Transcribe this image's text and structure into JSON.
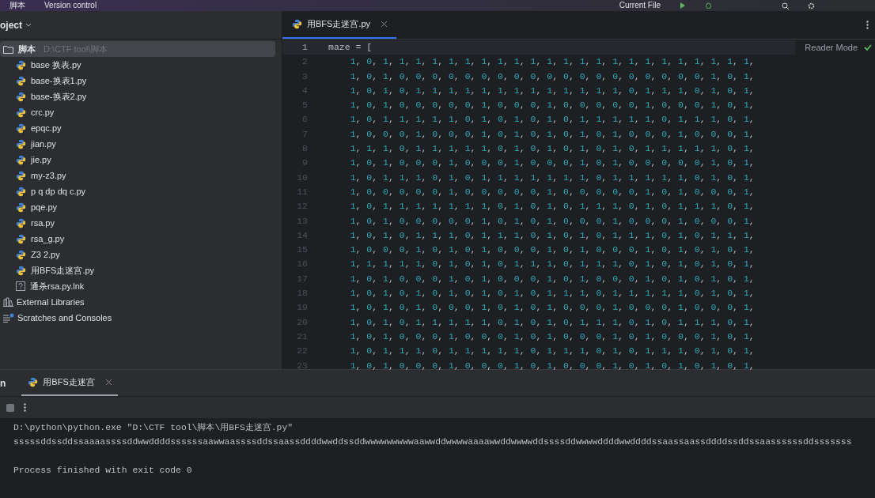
{
  "top_bar": {
    "project_name": "脚本",
    "vcs": "Version control",
    "run_config": "Current File"
  },
  "project_panel": {
    "title": "oject",
    "root": {
      "name": "脚本",
      "path": "D:\\CTF tool\\脚本",
      "selected": true,
      "children": [
        {
          "name": "base 换表.py",
          "kind": "python"
        },
        {
          "name": "base-换表1.py",
          "kind": "python"
        },
        {
          "name": "base-换表2.py",
          "kind": "python"
        },
        {
          "name": "crc.py",
          "kind": "python"
        },
        {
          "name": "epqc.py",
          "kind": "python"
        },
        {
          "name": "jian.py",
          "kind": "python"
        },
        {
          "name": "jie.py",
          "kind": "python"
        },
        {
          "name": "my-z3.py",
          "kind": "python"
        },
        {
          "name": "p q dp dq c.py",
          "kind": "python"
        },
        {
          "name": "pqe.py",
          "kind": "python"
        },
        {
          "name": "rsa.py",
          "kind": "python"
        },
        {
          "name": "rsa_g.py",
          "kind": "python"
        },
        {
          "name": "Z3 2.py",
          "kind": "python"
        },
        {
          "name": "用BFS走迷宫.py",
          "kind": "python"
        },
        {
          "name": "通杀rsa.py.lnk",
          "kind": "unknown"
        }
      ]
    },
    "extras": [
      {
        "name": "External Libraries",
        "kind": "library"
      },
      {
        "name": "Scratches and Consoles",
        "kind": "scratch"
      }
    ]
  },
  "editor": {
    "tabs": [
      {
        "label": "用BFS走迷宫.py",
        "selected": true
      }
    ],
    "reader_mode": "Reader Mode",
    "lines": [
      {
        "number": "1",
        "text": "maze = [",
        "current": true
      },
      {
        "number": "2",
        "text": "    1, 0, 1, 1, 1, 1, 1, 1, 1, 1, 1, 1, 1, 1, 1, 1, 1, 1, 1, 1, 1, 1, 1, 1, 1,",
        "current": false
      },
      {
        "number": "3",
        "text": "    1, 0, 1, 0, 0, 0, 0, 0, 0, 0, 0, 0, 0, 0, 0, 0, 0, 0, 0, 0, 0, 0, 1, 0, 1,",
        "current": false
      },
      {
        "number": "4",
        "text": "    1, 0, 1, 0, 1, 1, 1, 1, 1, 1, 1, 1, 1, 1, 1, 1, 1, 0, 1, 1, 1, 0, 1, 0, 1,",
        "current": false
      },
      {
        "number": "5",
        "text": "    1, 0, 1, 0, 0, 0, 0, 0, 1, 0, 0, 0, 1, 0, 0, 0, 0, 0, 1, 0, 0, 0, 1, 0, 1,",
        "current": false
      },
      {
        "number": "6",
        "text": "    1, 0, 1, 1, 1, 1, 1, 0, 1, 0, 1, 0, 1, 0, 1, 1, 1, 1, 1, 0, 1, 1, 1, 0, 1,",
        "current": false
      },
      {
        "number": "7",
        "text": "    1, 0, 0, 0, 1, 0, 0, 0, 1, 0, 1, 0, 1, 0, 1, 0, 1, 0, 0, 0, 1, 0, 0, 0, 1,",
        "current": false
      },
      {
        "number": "8",
        "text": "    1, 1, 1, 0, 1, 1, 1, 1, 1, 0, 1, 0, 1, 0, 1, 0, 1, 0, 1, 1, 1, 1, 1, 0, 1,",
        "current": false
      },
      {
        "number": "9",
        "text": "    1, 0, 1, 0, 0, 0, 1, 0, 0, 0, 1, 0, 0, 0, 1, 0, 1, 0, 0, 0, 0, 0, 1, 0, 1,",
        "current": false
      },
      {
        "number": "10",
        "text": "    1, 0, 1, 1, 1, 0, 1, 0, 1, 1, 1, 1, 1, 1, 1, 0, 1, 1, 1, 1, 1, 0, 1, 0, 1,",
        "current": false
      },
      {
        "number": "11",
        "text": "    1, 0, 0, 0, 0, 0, 1, 0, 0, 0, 0, 0, 1, 0, 0, 0, 0, 0, 1, 0, 1, 0, 0, 0, 1,",
        "current": false
      },
      {
        "number": "12",
        "text": "    1, 0, 1, 1, 1, 1, 1, 1, 1, 0, 1, 0, 1, 0, 1, 1, 1, 0, 1, 0, 1, 1, 1, 0, 1,",
        "current": false
      },
      {
        "number": "13",
        "text": "    1, 0, 1, 0, 0, 0, 0, 0, 1, 0, 1, 0, 1, 0, 0, 0, 1, 0, 0, 0, 1, 0, 0, 0, 1,",
        "current": false
      },
      {
        "number": "14",
        "text": "    1, 0, 1, 0, 1, 1, 1, 0, 1, 1, 1, 0, 1, 0, 1, 0, 1, 1, 1, 0, 1, 0, 1, 1, 1,",
        "current": false
      },
      {
        "number": "15",
        "text": "    1, 0, 0, 0, 1, 0, 1, 0, 1, 0, 0, 0, 1, 0, 1, 0, 0, 0, 1, 0, 1, 0, 1, 0, 1,",
        "current": false
      },
      {
        "number": "16",
        "text": "    1, 1, 1, 1, 1, 0, 1, 0, 1, 0, 1, 1, 1, 0, 1, 1, 1, 0, 1, 0, 1, 0, 1, 0, 1,",
        "current": false
      },
      {
        "number": "17",
        "text": "    1, 0, 1, 0, 0, 0, 1, 0, 1, 0, 0, 0, 1, 0, 1, 0, 0, 0, 1, 0, 1, 0, 1, 0, 1,",
        "current": false
      },
      {
        "number": "18",
        "text": "    1, 0, 1, 0, 1, 0, 1, 0, 1, 0, 1, 0, 1, 1, 1, 0, 1, 1, 1, 1, 1, 0, 1, 0, 1,",
        "current": false
      },
      {
        "number": "19",
        "text": "    1, 0, 1, 0, 1, 0, 0, 0, 1, 0, 1, 0, 1, 0, 0, 0, 1, 0, 0, 0, 1, 0, 0, 0, 1,",
        "current": false
      },
      {
        "number": "20",
        "text": "    1, 0, 1, 0, 1, 1, 1, 1, 1, 0, 1, 0, 1, 0, 1, 1, 1, 0, 1, 0, 1, 1, 1, 0, 1,",
        "current": false
      },
      {
        "number": "21",
        "text": "    1, 0, 1, 0, 0, 0, 1, 0, 0, 0, 1, 0, 1, 0, 0, 0, 1, 0, 1, 0, 0, 0, 1, 0, 1,",
        "current": false
      },
      {
        "number": "22",
        "text": "    1, 0, 1, 1, 1, 0, 1, 1, 1, 1, 1, 0, 1, 1, 1, 0, 1, 0, 1, 1, 1, 0, 1, 0, 1,",
        "current": false
      },
      {
        "number": "23",
        "text": "    1, 0, 1, 0, 0, 0, 1, 0, 0, 0, 1, 0, 1, 0, 0, 0, 1, 0, 1, 0, 1, 0, 1, 0, 1,",
        "current": false
      }
    ]
  },
  "run_panel": {
    "title": "n",
    "tabs": [
      {
        "label": "用BFS走迷宫",
        "selected": true
      }
    ],
    "output": [
      {
        "kind": "command",
        "text": "D:\\python\\python.exe \"D:\\CTF tool\\脚本\\用BFS走迷宫.py\""
      },
      {
        "kind": "stdout",
        "text": "sssssddssddssaaaassssddwwddddssssssaawwaassssddssaassddddwwddssddwwwwwwwwwaawwddwwwwaaaawwddwwwwddssssddwwwwddddwwddddssaassaassddddssddssaassssssddsssssss"
      },
      {
        "kind": "exit",
        "text": "Process finished with exit code 0"
      }
    ]
  }
}
